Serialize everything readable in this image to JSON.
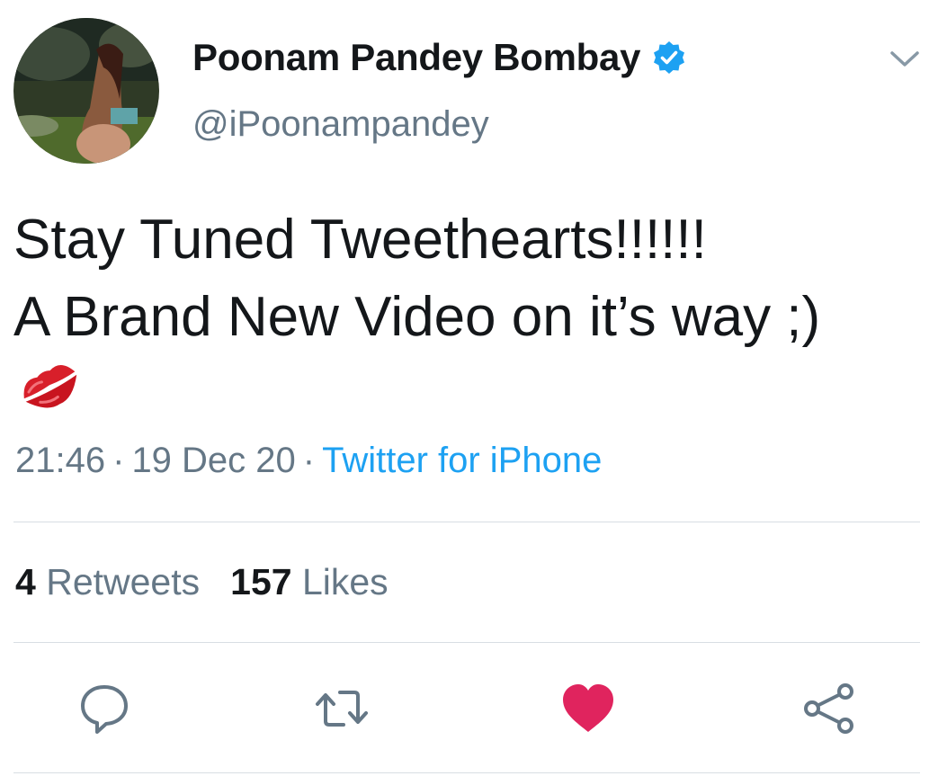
{
  "tweet": {
    "author": {
      "display_name": "Poonam Pandey Bombay",
      "handle": "@iPoonampandey",
      "verified": true
    },
    "text_lines": [
      "Stay Tuned Tweethearts!!!!!!",
      "A Brand New Video on it’s way ;)"
    ],
    "emoji": "kiss-mark",
    "time": "21:46",
    "date": "19 Dec 20",
    "separator": "·",
    "source": "Twitter for iPhone",
    "retweets": {
      "count": "4",
      "label": "Retweets"
    },
    "likes": {
      "count": "157",
      "label": "Likes"
    },
    "liked": true
  },
  "colors": {
    "text": "#14171a",
    "muted": "#657786",
    "link": "#1da1f2",
    "verified": "#1da1f2",
    "like": "#e0245e",
    "divider": "#d8dee3"
  },
  "icons": {
    "caret": "chevron-down-icon",
    "reply": "reply-icon",
    "retweet": "retweet-icon",
    "like": "heart-icon",
    "share": "share-icon"
  }
}
